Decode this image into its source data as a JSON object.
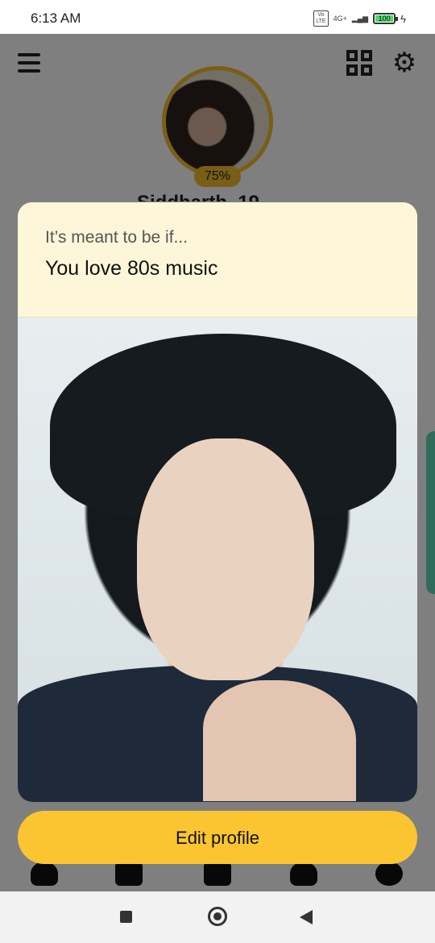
{
  "status_bar": {
    "time": "6:13 AM",
    "volte": "Vo\nLTE",
    "network": "4G+",
    "battery": "100"
  },
  "header": {
    "avatar_progress": "75%",
    "username": "Siddharth, 19"
  },
  "card": {
    "subtitle": "It’s meant to be if...",
    "title": "You love 80s music"
  },
  "actions": {
    "edit_profile": "Edit profile"
  },
  "colors": {
    "accent": "#fbc531",
    "card_header": "#fdf6d8",
    "overlay": "rgba(0,0,0,0.5)"
  },
  "icons": [
    "menu-icon",
    "qr-code-icon",
    "settings-gear-icon",
    "recents-icon",
    "home-icon",
    "back-icon"
  ]
}
